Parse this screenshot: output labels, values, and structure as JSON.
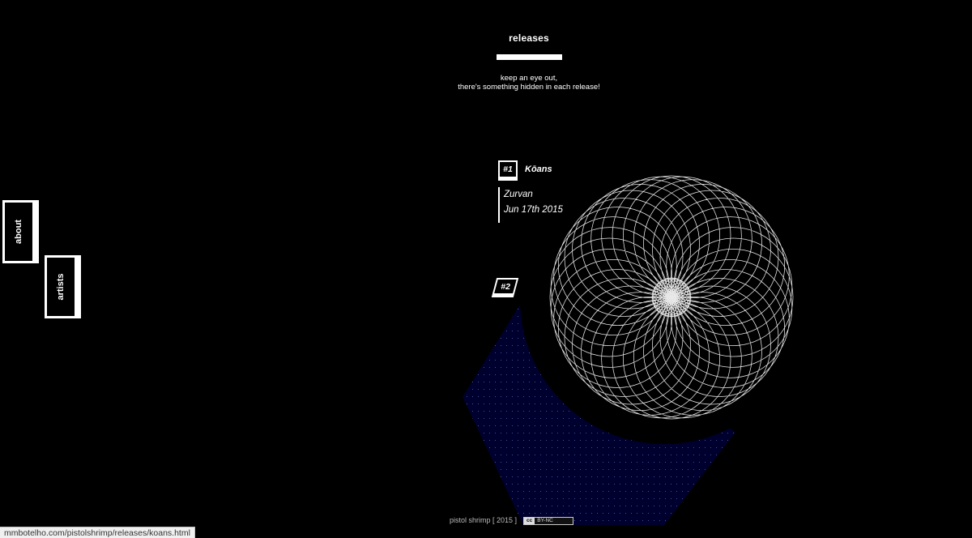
{
  "header": {
    "title": "releases",
    "hint_line1": "keep an eye out,",
    "hint_line2": "there's something hidden in each release!"
  },
  "nav": {
    "about": "about",
    "artists": "artists"
  },
  "releases": [
    {
      "number": "#1",
      "title": "Kōans",
      "artist": "Zurvan",
      "date": "Jun 17th 2015"
    },
    {
      "number": "#2"
    }
  ],
  "footer": {
    "credit": "pistol shrimp [ 2015 ]",
    "license_mark": "cc",
    "license": "BY-NC"
  },
  "status_bar": {
    "url": "mmbotelho.com/pistolshrimp/releases/koans.html"
  },
  "colors": {
    "background": "#000000",
    "foreground": "#ffffff",
    "hexagon_fill": "#000033"
  },
  "icons": {
    "artwork": "spirograph-pattern",
    "license": "creative-commons-badge"
  }
}
